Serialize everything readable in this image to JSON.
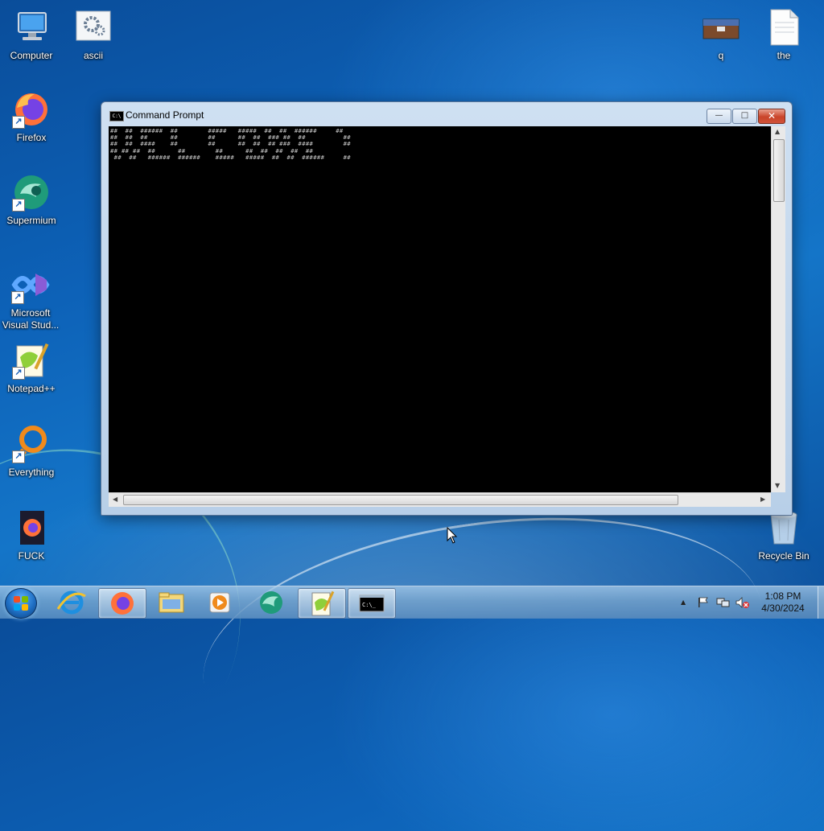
{
  "desktop": {
    "icons_left": [
      {
        "label": "Computer",
        "icon": "computer-icon"
      },
      {
        "label": "ascii",
        "icon": "settings-file-icon"
      },
      {
        "label": "Firefox",
        "icon": "firefox-icon"
      },
      {
        "label": "Supermium",
        "icon": "supermium-icon"
      },
      {
        "label": "Microsoft Visual Stud...",
        "icon": "vscode-icon"
      },
      {
        "label": "Notepad++",
        "icon": "notepadpp-icon"
      },
      {
        "label": "Everything",
        "icon": "everything-icon"
      },
      {
        "label": "FUCK",
        "icon": "firefox-file-icon"
      }
    ],
    "icons_right": [
      {
        "label": "q",
        "icon": "image-icon"
      },
      {
        "label": "the",
        "icon": "text-file-icon"
      },
      {
        "label": "Recycle Bin",
        "icon": "recycle-bin-icon"
      }
    ]
  },
  "window": {
    "title": "Command Prompt",
    "ascii_art": "##  ##  ######  ##        #####   #####  ##  ##  ######     ##\n##  ##  ##      ##        ##      ##  ##  ### ##  ##          ##\n##  ##  ####    ##        ##      ##  ##  ## ###  ####        ##\n## ## ##  ##      ##        ##      ##  ##  ##  ##  ##          \n ##  ##   ######  ######    #####   #####  ##  ##  ######     ##",
    "controls": {
      "minimize": "—",
      "maximize": "□",
      "close": "✕"
    }
  },
  "taskbar": {
    "apps": [
      {
        "name": "internet-explorer",
        "icon": "ie-icon",
        "active": false
      },
      {
        "name": "firefox",
        "icon": "firefox-icon",
        "active": true
      },
      {
        "name": "file-explorer",
        "icon": "folder-icon",
        "active": false
      },
      {
        "name": "media-player",
        "icon": "media-player-icon",
        "active": false
      },
      {
        "name": "supermium",
        "icon": "supermium-icon",
        "active": false
      },
      {
        "name": "notepadpp",
        "icon": "notepadpp-icon",
        "active": true
      },
      {
        "name": "command-prompt",
        "icon": "cmd-icon",
        "active": true
      }
    ],
    "tray": {
      "up_arrow": "▲",
      "time": "1:08 PM",
      "date": "4/30/2024"
    }
  },
  "colors": {
    "console_bg": "#000000",
    "console_text": "#c9c9c9",
    "desktop_blue": "#0d62b8"
  }
}
